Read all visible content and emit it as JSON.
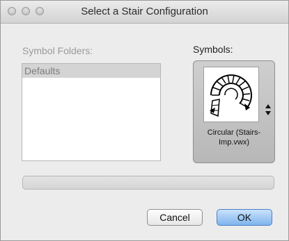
{
  "window": {
    "title": "Select a Stair Configuration"
  },
  "folders": {
    "label": "Symbol Folders:",
    "items": [
      {
        "label": "Defaults",
        "selected": true
      }
    ]
  },
  "symbols": {
    "label": "Symbols:",
    "current": {
      "name": "Circular (Stairs-Imp.vwx)",
      "icon": "circular-stair-icon"
    }
  },
  "progress": {
    "value": 0
  },
  "buttons": {
    "cancel": "Cancel",
    "ok": "OK"
  },
  "colors": {
    "default_button": "#7fb4ee",
    "selection": "#d4d4d4"
  }
}
